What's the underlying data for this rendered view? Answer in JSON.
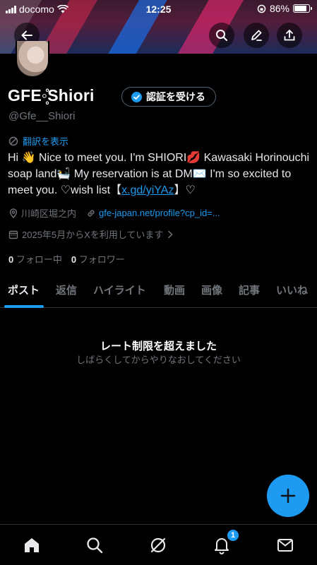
{
  "status_bar": {
    "carrier": "docomo",
    "time": "12:25",
    "battery": "86%",
    "battery_level": 0.86
  },
  "profile": {
    "display_name": "GFE◦̥̊Shiori",
    "verify_label": "認証を受ける",
    "handle": "@Gfe__Shiori",
    "translate_label": "翻訳を表示",
    "bio_part1": "Hi 👋 Nice to meet you. I'm SHIORI💋 Kawasaki Horinouchi soap land🛀 My reservation is at DM✉️ I'm so excited to meet you. ♡wish list【",
    "bio_link": "x.gd/yiYAz",
    "bio_part2": "】♡",
    "location": "川崎区堀之内",
    "website": "gfe-japan.net/profile?cp_id=...",
    "joined": "2025年5月からXを利用しています",
    "following_count": "0",
    "following_label": "フォロー中",
    "followers_count": "0",
    "followers_label": "フォロワー"
  },
  "tabs": [
    {
      "label": "ポスト",
      "active": true
    },
    {
      "label": "返信",
      "active": false
    },
    {
      "label": "ハイライト",
      "active": false
    },
    {
      "label": "動画",
      "active": false
    },
    {
      "label": "画像",
      "active": false
    },
    {
      "label": "記事",
      "active": false
    },
    {
      "label": "いいね",
      "active": false
    }
  ],
  "empty_state": {
    "title": "レート制限を超えました",
    "subtitle": "しばらくしてからやりなおしてください"
  },
  "nav": {
    "notifications_badge": "1"
  },
  "colors": {
    "accent": "#1d9bf0",
    "background": "#000000",
    "muted": "#71767b"
  },
  "icons": [
    "back-arrow-icon",
    "search-icon",
    "edit-icon",
    "share-icon",
    "verified-icon",
    "translate-icon",
    "location-icon",
    "link-icon",
    "calendar-icon",
    "chevron-right-icon",
    "plus-icon",
    "home-icon",
    "grok-icon",
    "bell-icon",
    "mail-icon"
  ]
}
